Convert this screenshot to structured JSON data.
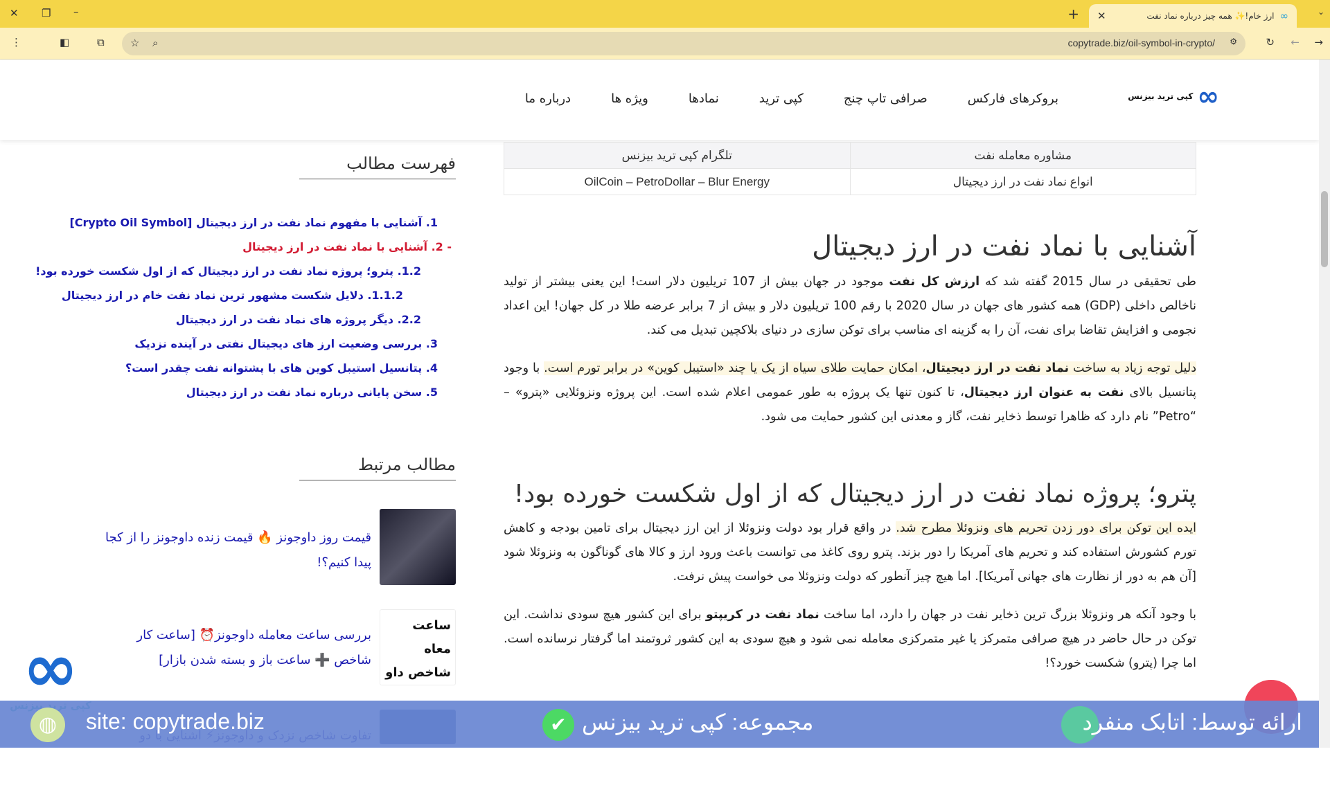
{
  "browser": {
    "tab_title": "ارز خام!✨ همه چیز درباره نماد نفت",
    "url": "copytrade.biz/oil-symbol-in-crypto/"
  },
  "header": {
    "logo_text": "کپی ترید بیزنس",
    "nav": [
      "بروکرهای فارکس",
      "صرافی تاپ چنج",
      "کپی ترید",
      "نمادها",
      "ویژه ها",
      "درباره ما"
    ]
  },
  "table": {
    "rows": [
      [
        "مشاوره معامله نفت",
        "تلگرام کپی ترید بیزنس"
      ],
      [
        "انواع نماد نفت در ارز دیجیتال",
        "OilCoin – PetroDollar – Blur Energy"
      ]
    ]
  },
  "article": {
    "h1": "آشنایی با نماد نفت در ارز دیجیتال",
    "p1": [
      "طی تحقیقی در سال 2015 گفته شد که ",
      "ارزش کل نفت",
      " موجود در جهان بیش از 107 تریلیون دلار است! این یعنی بیشتر از تولید ناخالص داخلی (GDP) همه کشور های جهان در سال 2020 با رقم 100 تریلیون دلار و بیش از 7 برابر عرضه طلا در کل جهان! این اعداد نجومی و افزایش تقاضا برای نفت، آن را به گزینه ای مناسب برای توکن سازی در دنیای بلاکچین تبدیل می کند."
    ],
    "p2": [
      "دلیل توجه زیاد به ساخت ",
      "نماد نفت در ارز دیجیتال",
      "، امکان حمایت طلای سیاه از یک یا چند «استیبل کوین» در برابر تورم است.",
      "  با وجود پتانسیل بالای ",
      "نفت به عنوان ارز دیجیتال",
      "، تا کنون تنها یک پروژه به طور عمومی اعلام شده است. این پروژه ونزوئلایی «پترو» – “Petro” نام دارد که ظاهرا توسط ذخایر نفت، گاز و معدنی این کشور حمایت می شود."
    ],
    "h2": "پترو؛ پروژه نماد نفت در ارز دیجیتال که از اول شکست خورده بود!",
    "p3": [
      "ایده این توکن برای دور زدن تحریم های ونزوئلا مطرح شد.",
      "  در واقع قرار بود دولت ونزوئلا از این ارز دیجیتال برای تامین بودجه و کاهش تورم کشورش استفاده کند و تحریم های آمریکا را دور بزند. پترو روی کاغذ می توانست باعث ورود ارز و کالا های گوناگون به ونزوئلا شود [آن هم به دور از نظارت های جهانی آمریکا]. اما هیچ چیز آنطور که دولت ونزوئلا می خواست پیش نرفت."
    ],
    "p4": [
      "با وجود آنکه هر ونزوئلا بزرگ ترین ذخایر نفت در جهان را دارد، اما ساخت ",
      "نماد نفت در کریپتو",
      " برای این کشور هیچ سودی نداشت. این توکن در حال حاضر در هیچ صرافی متمرکز یا غیر متمرکزی معامله نمی شود و هیچ سودی به این کشور ثروتمند اما گرفتار نرسانده است. اما چرا (پترو) شکست خورد؟!"
    ]
  },
  "sidebar": {
    "toc_title": "فهرست مطالب",
    "toc": [
      "1. آشنایی با مفهوم نماد نفت در ارز دیجیتال [Crypto Oil Symbol]",
      "- 2. آشنایی با نماد نفت در ارز دیجیتال",
      "1.2. پترو؛ پروژه نماد نفت در ارز دیجیتال که از اول شکست خورده بود!",
      "1.1.2. دلایل شکست مشهور ترین نماد نفت خام در ارز دیجیتال",
      "2.2. دیگر پروژه های نماد نفت در ارز دیجیتال",
      "3. بررسی وضعیت ارز های دیجیتال نفتی در آینده نزدیک",
      "4. پتانسیل استیبل کوین های با پشتوانه نفت چقدر است؟",
      "5. سخن پایانی درباره نماد نفت در ارز دیجیتال"
    ],
    "related_title": "مطالب مرتبط",
    "related": [
      "قیمت روز داوجونز 🔥 قیمت زنده داوجونز را از کجا پیدا کنیم؟!",
      "بررسی ساعت معامله داوجونز⏰ [ساعت کار شاخص ➕ ساعت باز و بسته شدن بازار]",
      "تفاوت شاخص نزدک و داوجونز⚡ آشنایی با دو"
    ],
    "thumb2_text": "ساعت معاه شاخص داو DOW JONES"
  },
  "banner": {
    "site": "site: copytrade.biz",
    "collection": "مجموعه: کپی ترید بیزنس",
    "presenter": "ارائه توسط: اتابک منفرد"
  },
  "colors": {
    "tabbar": "#f4d548",
    "link": "#1a1ab0",
    "active": "#d21b32",
    "banner": "#6885d2"
  }
}
